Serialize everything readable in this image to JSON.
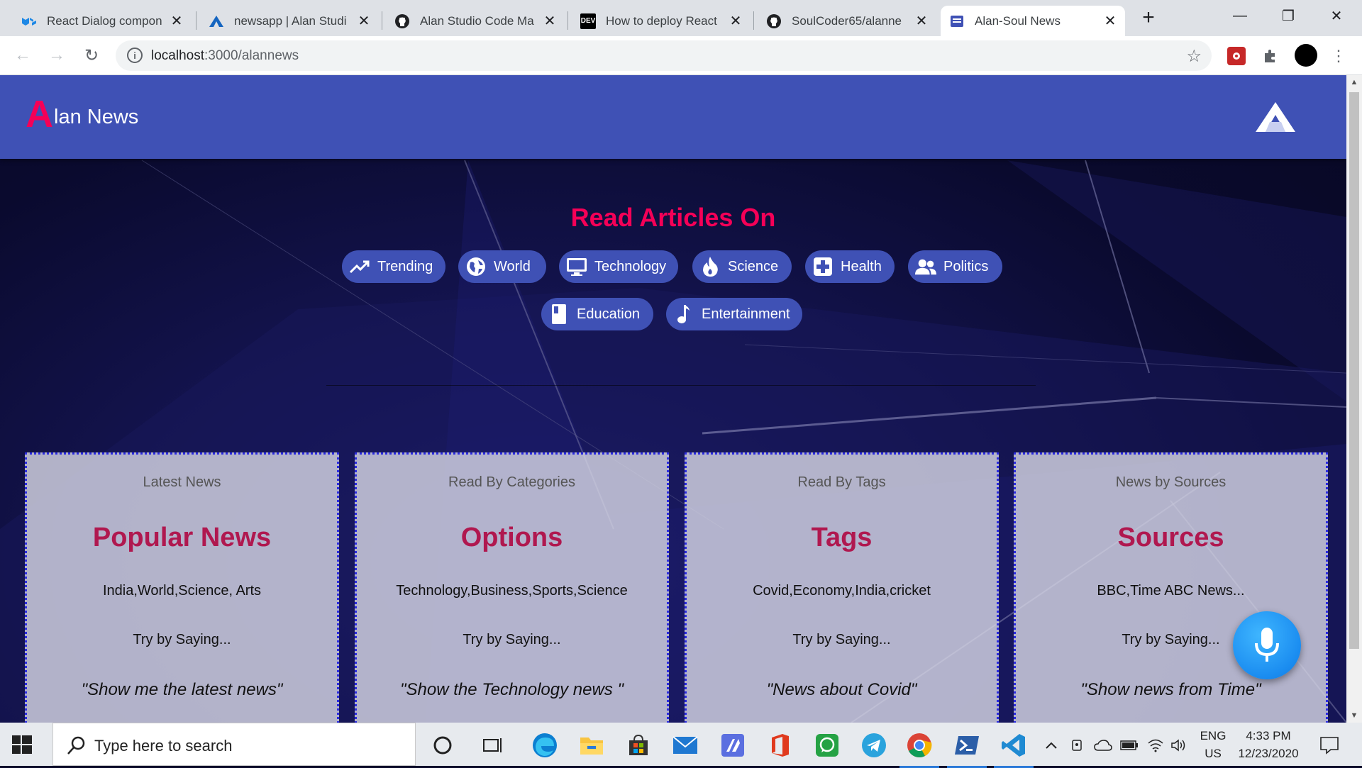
{
  "browser": {
    "tabs": [
      {
        "title": "React Dialog compon",
        "icon": "mui-logo-icon"
      },
      {
        "title": "newsapp | Alan Studi",
        "icon": "alan-logo-icon"
      },
      {
        "title": "Alan Studio Code Ma",
        "icon": "github-icon"
      },
      {
        "title": "How to deploy React",
        "icon": "dev-logo-icon"
      },
      {
        "title": "SoulCoder65/alanne",
        "icon": "github-icon"
      },
      {
        "title": "Alan-Soul News",
        "icon": "page-icon"
      }
    ],
    "active_tab_index": 5,
    "new_tab": "+",
    "url_host": "localhost",
    "url_path": ":3000/alannews"
  },
  "app": {
    "brand_initial": "A",
    "brand_rest": "lan News",
    "heading": "Read Articles On",
    "chips": [
      {
        "label": "Trending",
        "icon": "trending-up-icon"
      },
      {
        "label": "World",
        "icon": "globe-icon"
      },
      {
        "label": "Technology",
        "icon": "monitor-icon"
      },
      {
        "label": "Science",
        "icon": "flame-icon"
      },
      {
        "label": "Health",
        "icon": "medical-plus-icon"
      },
      {
        "label": "Politics",
        "icon": "people-icon"
      },
      {
        "label": "Education",
        "icon": "book-icon"
      },
      {
        "label": "Entertainment",
        "icon": "music-note-icon"
      }
    ],
    "cards": [
      {
        "over": "Latest News",
        "title": "Popular News",
        "text": "India,World,Science, Arts",
        "try": "Try by Saying...",
        "quote": "\"Show me the latest news\""
      },
      {
        "over": "Read By Categories",
        "title": "Options",
        "text": "Technology,Business,Sports,Science",
        "try": "Try by Saying...",
        "quote": "\"Show the Technology news \""
      },
      {
        "over": "Read By Tags",
        "title": "Tags",
        "text": "Covid,Economy,India,cricket",
        "try": "Try by Saying...",
        "quote": "\"News about Covid\""
      },
      {
        "over": "News by Sources",
        "title": "Sources",
        "text": "BBC,Time ABC News...",
        "try": "Try by Saying...",
        "quote": "\"Show news from Time\""
      }
    ],
    "colors": {
      "appbar": "#3f51b5",
      "accent": "#f50057",
      "card_title": "#b0184f",
      "mic": "#1a8cf0"
    }
  },
  "taskbar": {
    "search_placeholder": "Type here to search",
    "lang_1": "ENG",
    "lang_2": "US",
    "time": "4:33 PM",
    "date": "12/23/2020"
  }
}
